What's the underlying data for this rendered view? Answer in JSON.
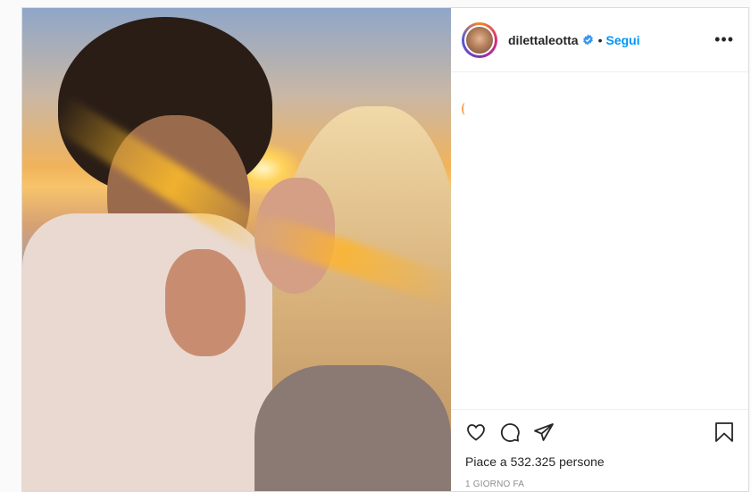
{
  "post": {
    "username": "dilettaleotta",
    "separator": "•",
    "follow_label": "Segui",
    "more_label": "•••",
    "likes_text": "Piace a 532.325 persone",
    "timestamp": "1 GIORNO FA"
  },
  "icons": {
    "like": "heart-icon",
    "comment": "comment-icon",
    "share": "share-icon",
    "save": "bookmark-icon",
    "verified": "verified-badge-icon"
  },
  "colors": {
    "accent": "#0095f6",
    "text": "#262626",
    "muted": "#8e8e8e"
  }
}
